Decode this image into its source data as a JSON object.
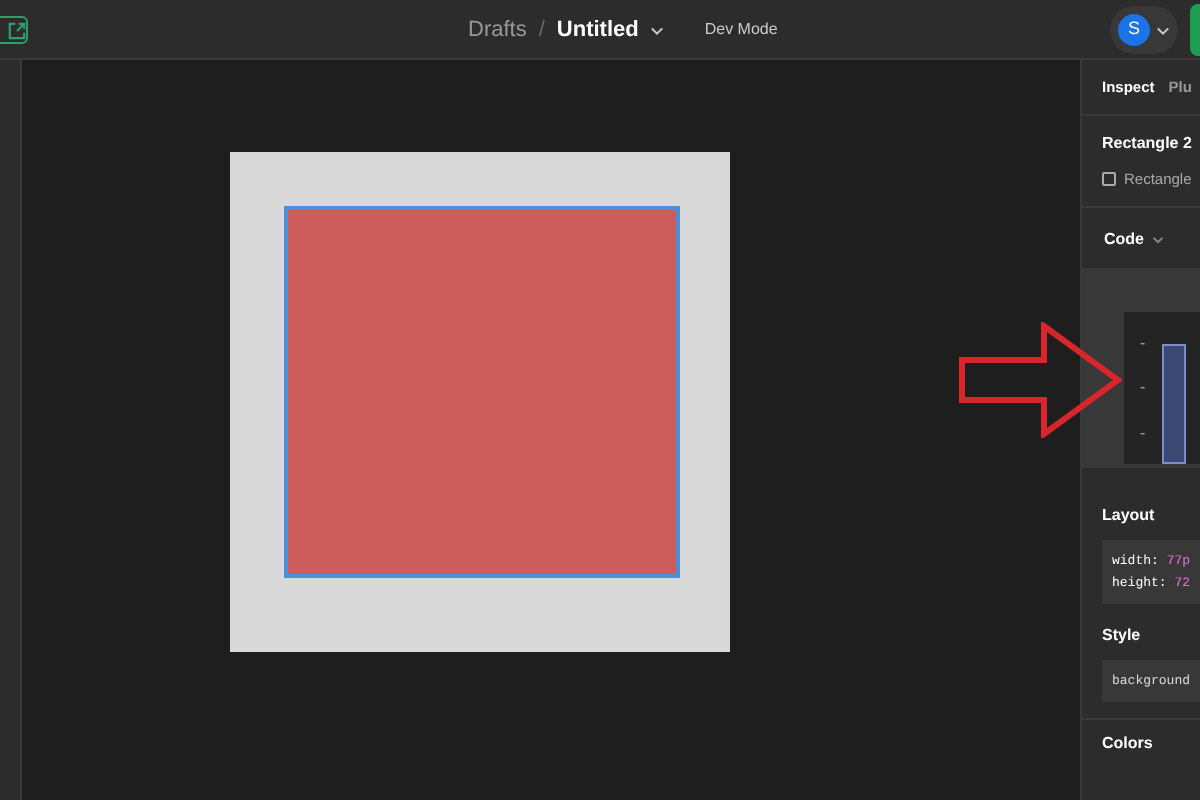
{
  "topbar": {
    "breadcrumb_parent": "Drafts",
    "separator": "/",
    "file_name": "Untitled",
    "mode_label": "Dev Mode",
    "avatar_initial": "S"
  },
  "canvas": {
    "shape_selected": true
  },
  "inspect_panel": {
    "tabs": [
      {
        "label": "Inspect",
        "selected": true
      },
      {
        "label": "Plu",
        "selected": false
      }
    ],
    "layer_name": "Rectangle 2",
    "layer_type": "Rectangle",
    "code_title": "Code",
    "box_model": {
      "markers": [
        "-",
        "-",
        "-"
      ]
    },
    "layout_title": "Layout",
    "layout_lines": [
      {
        "property": "width:",
        "value": "77p"
      },
      {
        "property": "height:",
        "value": "72"
      }
    ],
    "style_title": "Style",
    "style_lines": [
      {
        "property": "background"
      }
    ],
    "colors_title": "Colors"
  }
}
